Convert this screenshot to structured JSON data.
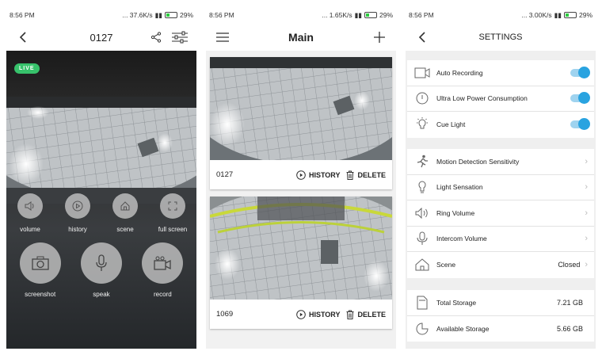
{
  "live_screen": {
    "status": {
      "time": "8:56 PM",
      "speed": "... 37.6K/s",
      "battery": "29%"
    },
    "title": "0127",
    "badge": "LIVE",
    "controls_small": [
      {
        "label": "volume",
        "icon": "volume-icon"
      },
      {
        "label": "history",
        "icon": "play-history-icon"
      },
      {
        "label": "scene",
        "icon": "home-scene-icon"
      },
      {
        "label": "full screen",
        "icon": "fullscreen-icon"
      }
    ],
    "controls_large": [
      {
        "label": "screenshot",
        "icon": "camera-icon"
      },
      {
        "label": "speak",
        "icon": "microphone-icon"
      },
      {
        "label": "record",
        "icon": "video-record-icon"
      }
    ]
  },
  "main_screen": {
    "status": {
      "time": "8:56 PM",
      "speed": "... 1.65K/s",
      "battery": "29%"
    },
    "title": "Main",
    "history_label": "HISTORY",
    "delete_label": "DELETE",
    "devices": [
      {
        "name": "0127"
      },
      {
        "name": "1069"
      }
    ]
  },
  "settings_screen": {
    "status": {
      "time": "8:56 PM",
      "speed": "... 3.00K/s",
      "battery": "29%"
    },
    "title": "SETTINGS",
    "toggles": [
      {
        "label": "Auto Recording",
        "icon": "camera-outline-icon",
        "on": true
      },
      {
        "label": "Ultra Low Power Consumption",
        "icon": "power-icon",
        "on": true
      },
      {
        "label": "Cue Light",
        "icon": "bulb-icon",
        "on": true
      }
    ],
    "options": [
      {
        "label": "Motion Detection Sensitivity",
        "icon": "running-icon",
        "value": ""
      },
      {
        "label": "Light Sensation",
        "icon": "light-sensor-icon",
        "value": ""
      },
      {
        "label": "Ring Volume",
        "icon": "speaker-icon",
        "value": ""
      },
      {
        "label": "Intercom Volume",
        "icon": "microphone-icon",
        "value": ""
      },
      {
        "label": "Scene",
        "icon": "home-icon",
        "value": "Closed"
      }
    ],
    "storage": [
      {
        "label": "Total Storage",
        "icon": "sd-card-icon",
        "value": "7.21 GB"
      },
      {
        "label": "Available Storage",
        "icon": "pie-icon",
        "value": "5.66 GB"
      }
    ]
  },
  "colors": {
    "accent": "#29a3e0",
    "live": "#37c26b"
  }
}
